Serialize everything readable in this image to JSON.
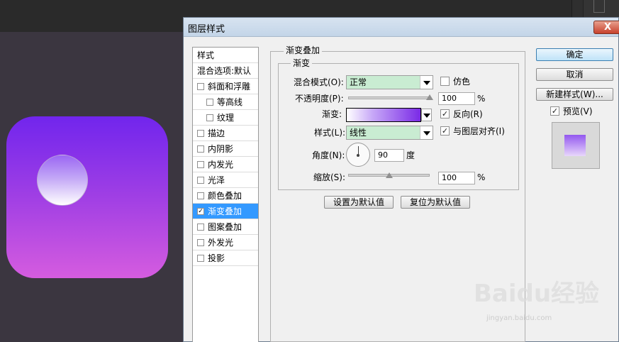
{
  "dialog": {
    "title": "图层样式",
    "close_glyph": "X"
  },
  "sidebar": {
    "header": "样式",
    "blend_options": "混合选项:默认",
    "items": [
      {
        "label": "斜面和浮雕",
        "checked": false
      },
      {
        "label": "等高线",
        "checked": false,
        "sub": true
      },
      {
        "label": "纹理",
        "checked": false,
        "sub": true
      },
      {
        "label": "描边",
        "checked": false
      },
      {
        "label": "内阴影",
        "checked": false
      },
      {
        "label": "内发光",
        "checked": false
      },
      {
        "label": "光泽",
        "checked": false
      },
      {
        "label": "颜色叠加",
        "checked": false
      },
      {
        "label": "渐变叠加",
        "checked": true,
        "selected": true
      },
      {
        "label": "图案叠加",
        "checked": false
      },
      {
        "label": "外发光",
        "checked": false
      },
      {
        "label": "投影",
        "checked": false
      }
    ],
    "check_glyph": "✓"
  },
  "panel": {
    "outer_title": "渐变叠加",
    "inner_title": "渐变",
    "blend_mode_label": "混合模式(O):",
    "blend_mode_value": "正常",
    "dither_label": "仿色",
    "opacity_label": "不透明度(P):",
    "opacity_value": "100",
    "opacity_level": 1.0,
    "percent": "%",
    "gradient_label": "渐变:",
    "gradient_colors": [
      "#ffffff",
      "#c7a8f7",
      "#7a2ae6"
    ],
    "reverse_label": "反向(R)",
    "reverse_checked": true,
    "style_label": "样式(L):",
    "style_value": "线性",
    "align_label": "与图层对齐(I)",
    "align_checked": true,
    "angle_label": "角度(N):",
    "angle_value": "90",
    "degree": "度",
    "scale_label": "缩放(S):",
    "scale_value": "100",
    "scale_level": 0.5,
    "set_default": "设置为默认值",
    "reset_default": "复位为默认值"
  },
  "buttons": {
    "ok": "确定",
    "cancel": "取消",
    "new_style": "新建样式(W)...",
    "preview_label": "预览(V)",
    "preview_checked": true
  },
  "canvas": {
    "icon_gradient": [
      "#7125ed",
      "#a03fe4",
      "#d55cdf"
    ],
    "ball_gradient": [
      "#9b67f3",
      "#c2a6f6",
      "#ffffff"
    ]
  },
  "watermark": {
    "brand": "Baidu经验",
    "url": "jingyan.baidu.com"
  }
}
